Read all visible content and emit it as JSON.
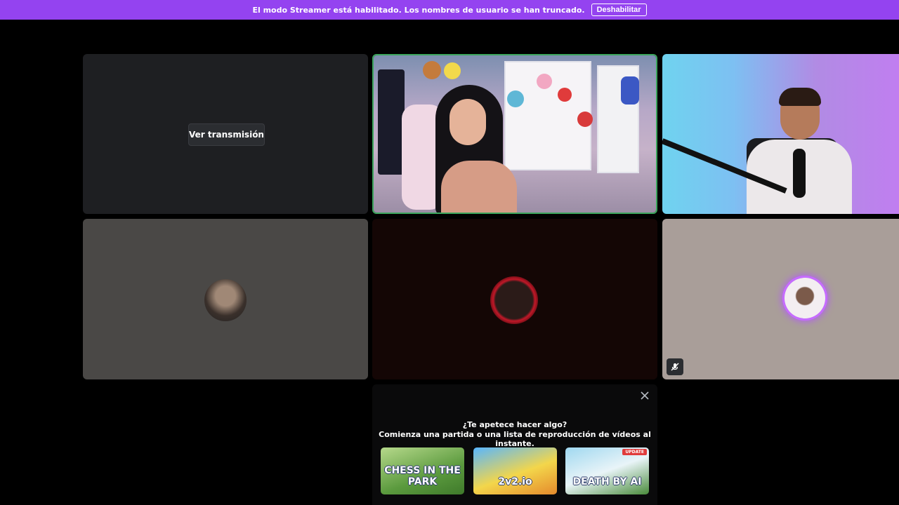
{
  "banner": {
    "message": "El modo Streamer está habilitado. Los nombres de usuario se han truncado.",
    "disable_label": "Deshabilitar",
    "color": "#9443f0"
  },
  "tiles": {
    "watch_stream_label": "Ver transmisión",
    "speaking_border_color": "#3ba55c",
    "muted_icon": "mic-muted-icon"
  },
  "activity_panel": {
    "title_line1": "¿Te apetece hacer algo?",
    "title_line2": "Comienza una partida o una lista de reproducción de vídeos al instante.",
    "close_icon": "close-icon",
    "games": [
      {
        "name": "CHESS IN THE PARK"
      },
      {
        "name": "2v2.io"
      },
      {
        "name": "DEATH BY AI",
        "badge": "UPDATE"
      }
    ]
  }
}
